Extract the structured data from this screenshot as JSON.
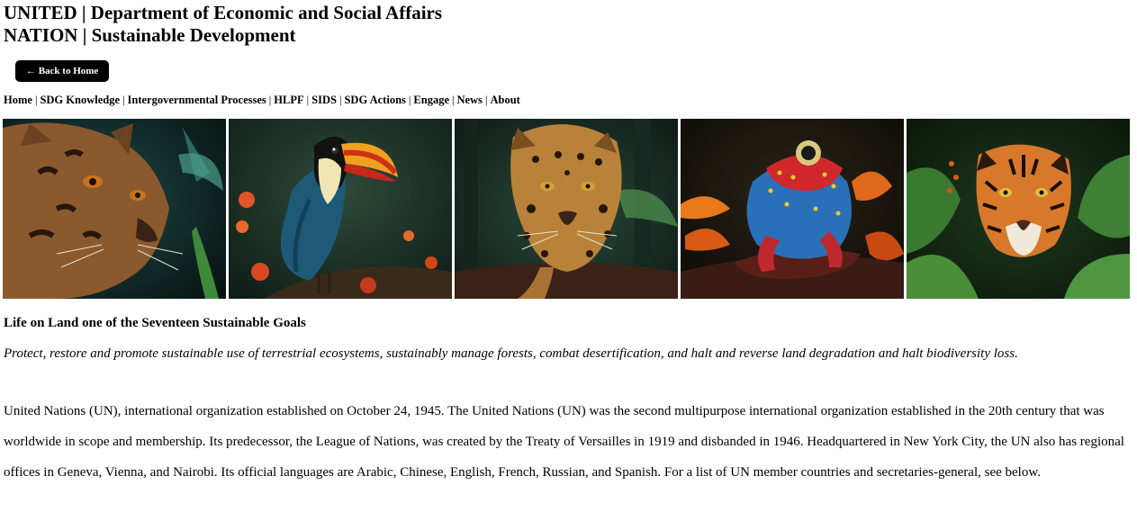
{
  "header": {
    "line1": "UNITED | Department of Economic and Social Affairs",
    "line2": "NATION | Sustainable Development"
  },
  "back_button": {
    "arrow": "←",
    "label": "Back to Home"
  },
  "nav": {
    "separator": "|",
    "items": [
      "Home",
      "SDG Knowledge",
      "Intergovernmental Processes",
      "HLPF",
      "SIDS",
      "SDG Actions",
      "Engage",
      "News",
      "About"
    ]
  },
  "gallery": {
    "images": [
      {
        "icon": "ocelot-image"
      },
      {
        "icon": "toucan-image"
      },
      {
        "icon": "jaguar-image"
      },
      {
        "icon": "frog-image"
      },
      {
        "icon": "tiger-image"
      }
    ]
  },
  "goal": {
    "title": "Life on Land one of the Seventeen Sustainable Goals",
    "description": "Protect, restore and promote sustainable use of terrestrial ecosystems, sustainably manage forests, combat desertification, and halt and reverse land degradation and halt biodiversity loss."
  },
  "intro": {
    "text": "United Nations (UN), international organization established on October 24, 1945. The United Nations (UN) was the second multipurpose international organization established in the 20th century that was worldwide in scope and membership. Its predecessor, the League of Nations, was created by the Treaty of Versailles in 1919 and disbanded in 1946. Headquartered in New York City, the UN also has regional offices in Geneva, Vienna, and Nairobi. Its official languages are Arabic, Chinese, English, French, Russian, and Spanish. For a list of UN member countries and secretaries-general, see below."
  }
}
